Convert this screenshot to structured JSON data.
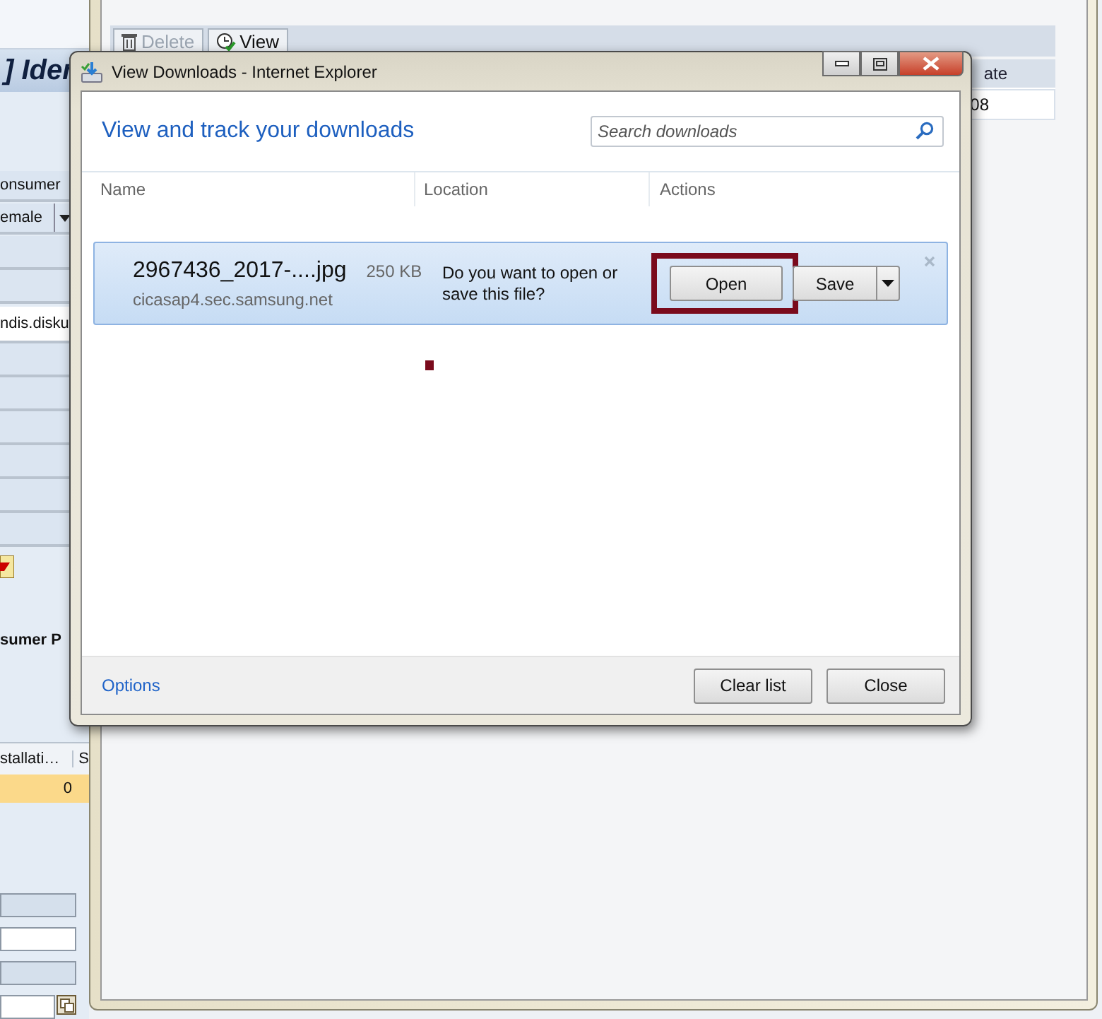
{
  "sap_panel": {
    "title": "] Ider",
    "fields": [
      {
        "kind": "field",
        "value": "onsumer"
      },
      {
        "kind": "dropdown",
        "value": "emale"
      },
      {
        "kind": "input",
        "value": "ndis.disku"
      }
    ],
    "section_title": "sumer P",
    "table": {
      "columns": [
        "stallati…",
        "S"
      ],
      "rows": [
        {
          "cells": [
            "0"
          ],
          "selected": true
        }
      ]
    }
  },
  "background_window": {
    "toolbar": [
      {
        "label": "Delete",
        "disabled": true
      },
      {
        "label": "View",
        "disabled": false
      }
    ],
    "table": {
      "column": "ate",
      "cell": "08"
    }
  },
  "dialog": {
    "title": "View Downloads - Internet Explorer",
    "heading": "View and track your downloads",
    "search": {
      "placeholder": "Search downloads"
    },
    "columns": [
      "Name",
      "Location",
      "Actions"
    ],
    "downloads": [
      {
        "name": "2967436_2017-....jpg",
        "size": "250 KB",
        "source": "cicasap4.sec.samsung.net",
        "location": "Do you want to open or save this file?",
        "selected": true,
        "actions": [
          {
            "kind": "button",
            "label": "Open",
            "highlighted": true
          },
          {
            "kind": "split",
            "label": "Save",
            "highlighted": false
          }
        ]
      }
    ],
    "options_link": "Options",
    "buttons": [
      "Clear list",
      "Close"
    ]
  }
}
